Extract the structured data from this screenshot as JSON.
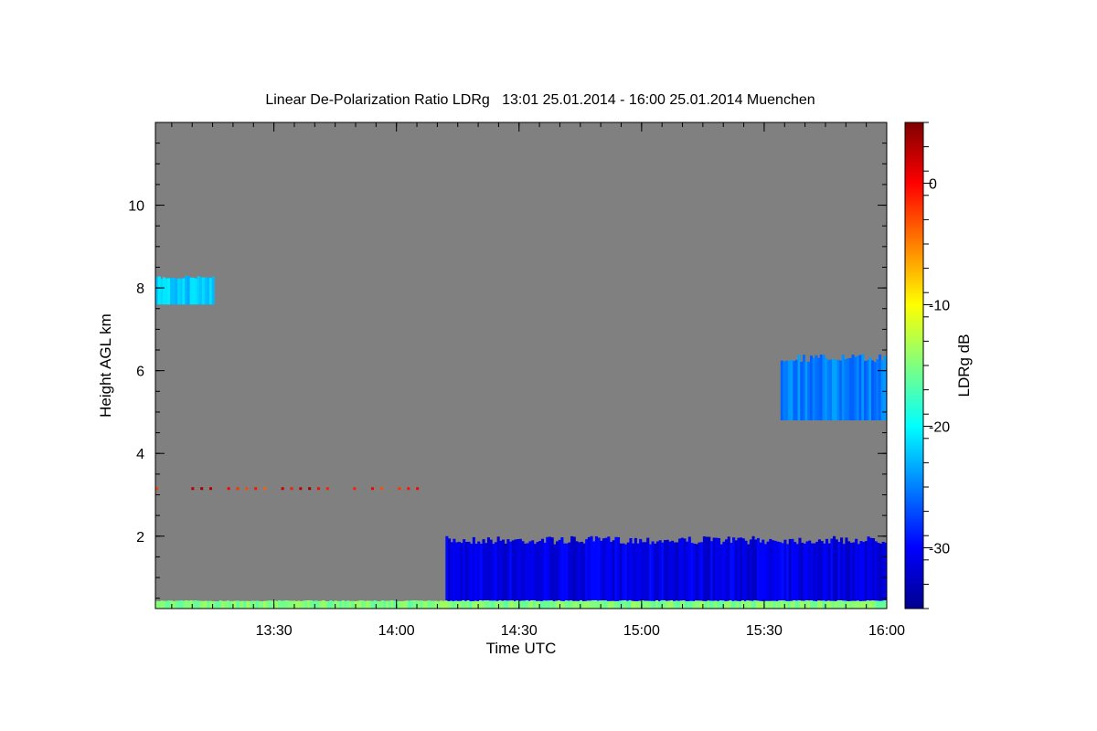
{
  "chart_data": {
    "type": "heatmap",
    "title": "Linear De-Polarization Ratio LDRg   13:01 25.01.2014 - 16:00 25.01.2014 Muenchen",
    "xlabel": "Time UTC",
    "ylabel": "Height AGL km",
    "x_range_utc": [
      "13:01",
      "16:00"
    ],
    "x_range_min": [
      781,
      960
    ],
    "ylim_km": [
      0.25,
      12
    ],
    "x_ticks": [
      {
        "label": "13:30",
        "min": 810
      },
      {
        "label": "14:00",
        "min": 840
      },
      {
        "label": "14:30",
        "min": 870
      },
      {
        "label": "15:00",
        "min": 900
      },
      {
        "label": "15:30",
        "min": 930
      },
      {
        "label": "16:00",
        "min": 960
      }
    ],
    "x_minor_step_min": 5,
    "y_ticks": [
      2,
      4,
      6,
      8,
      10
    ],
    "y_minor_step_km": 0.5,
    "background_color": "#808080",
    "colorbar": {
      "label": "LDRg dB",
      "range": [
        -35,
        5
      ],
      "ticks": [
        0,
        -10,
        -20,
        -30
      ],
      "colormap": "jet"
    },
    "features": [
      {
        "name": "boundary layer / low cloud",
        "t_start": 852,
        "t_end": 960,
        "z_bottom": 0.35,
        "z_top": 2.0,
        "ldr_db": -31
      },
      {
        "name": "cirrus east",
        "t_start": 934,
        "t_end": 960,
        "z_bottom": 4.8,
        "z_top": 6.4,
        "ldr_db": -25
      },
      {
        "name": "cirrus west",
        "t_start": 781,
        "t_end": 795,
        "z_bottom": 7.6,
        "z_top": 8.3,
        "ldr_db": -22
      },
      {
        "name": "near-ground layer",
        "t_start": 781,
        "t_end": 960,
        "z_bottom": 0.25,
        "z_top": 0.45,
        "ldr_db": -15
      },
      {
        "name": "aerosol dots ~3.1 km",
        "t_start": 781,
        "t_end": 850,
        "z": 3.15,
        "ldr_db": 0
      }
    ]
  }
}
